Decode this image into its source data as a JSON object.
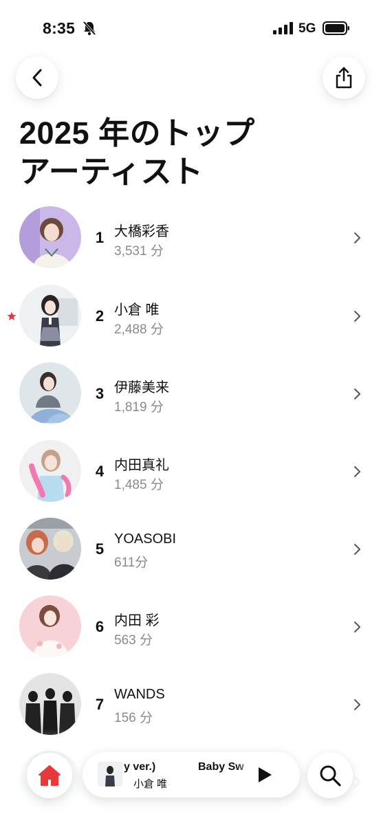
{
  "status_bar": {
    "time": "8:35",
    "network": "5G"
  },
  "header": {
    "back_icon": "chevron-left-icon",
    "share_icon": "share-icon"
  },
  "title": {
    "line1": "2025 年のトップ",
    "line2": "アーティスト"
  },
  "artists": [
    {
      "rank": "1",
      "name": "大橋彩香",
      "minutes": "3,531 分",
      "favorite": false
    },
    {
      "rank": "2",
      "name": "小倉 唯",
      "minutes": "2,488 分",
      "favorite": true
    },
    {
      "rank": "3",
      "name": "伊藤美来",
      "minutes": "1,819 分",
      "favorite": false
    },
    {
      "rank": "4",
      "name": "内田真礼",
      "minutes": "1,485 分",
      "favorite": false
    },
    {
      "rank": "5",
      "name": "YOASOBI",
      "minutes": "611分",
      "favorite": false
    },
    {
      "rank": "6",
      "name": "内田 彩",
      "minutes": "563 分",
      "favorite": false
    },
    {
      "rank": "7",
      "name": "WANDS",
      "minutes": "156 分",
      "favorite": false
    }
  ],
  "player": {
    "track_a": "y ver.)",
    "track_b": "Baby Sw",
    "artist": "小倉 唯",
    "play_icon": "play-icon"
  },
  "dock": {
    "home_icon": "home-icon",
    "search_icon": "search-icon"
  },
  "colors": {
    "home_red": "#e8383a",
    "favorite_star": "#e0363e",
    "minutes_gray": "#8a8a8a"
  }
}
